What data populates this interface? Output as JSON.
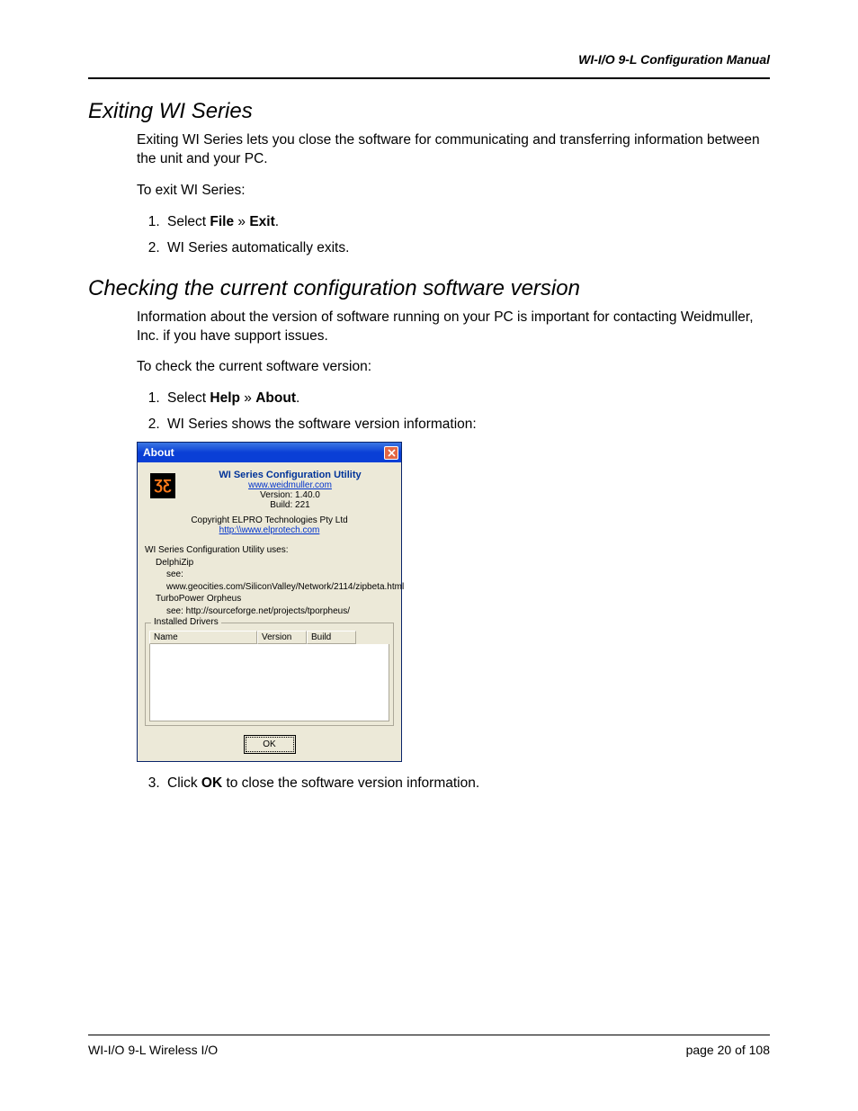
{
  "header": {
    "title": "WI-I/O 9-L Configuration Manual"
  },
  "section1": {
    "heading": "Exiting WI Series",
    "para1": "Exiting WI Series lets you close the software for communicating and transferring information between the unit and your PC.",
    "para2": "To exit WI Series:",
    "step1_a": "Select ",
    "step1_b": "File",
    "step1_c": " » ",
    "step1_d": "Exit",
    "step1_e": ".",
    "step2": "WI Series automatically exits."
  },
  "section2": {
    "heading": "Checking the current configuration software version",
    "para1": "Information about the version of software running on your PC is important for contacting Weidmuller, Inc. if you have support issues.",
    "para2": "To check the current software version:",
    "step1_a": "Select ",
    "step1_b": "Help",
    "step1_c": " » ",
    "step1_d": "About",
    "step1_e": ".",
    "step2": "WI Series shows the software version information:",
    "step3_a": "Click ",
    "step3_b": "OK",
    "step3_c": " to close the software version information."
  },
  "dialog": {
    "title": "About",
    "app_title": "WI Series Configuration Utility",
    "url1": "www.weidmuller.com",
    "version": "Version: 1.40.0",
    "build": "Build: 221",
    "copyright": "Copyright ELPRO Technologies Pty Ltd",
    "url2": "http:\\\\www.elprotech.com",
    "uses_label": "WI Series Configuration Utility uses:",
    "uses1": "DelphiZip",
    "uses1_see": "see: www.geocities.com/SiliconValley/Network/2114/zipbeta.html",
    "uses2": "TurboPower Orpheus",
    "uses2_see": "see: http://sourceforge.net/projects/tporpheus/",
    "drivers_legend": "Installed Drivers",
    "col_name": "Name",
    "col_version": "Version",
    "col_build": "Build",
    "ok": "OK"
  },
  "footer": {
    "left": "WI-I/O 9-L Wireless I/O",
    "right": "page 20 of 108"
  }
}
